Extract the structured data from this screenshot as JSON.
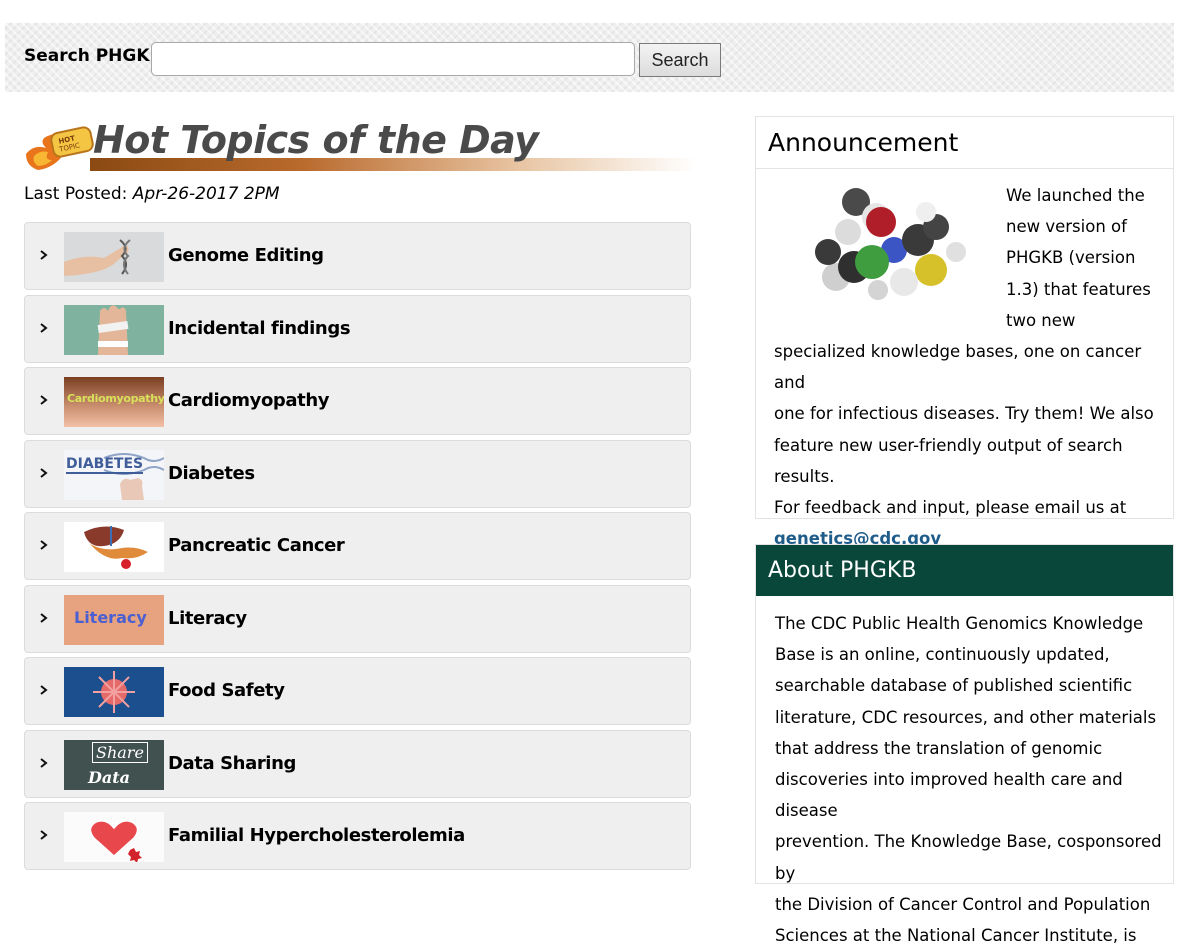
{
  "search": {
    "label": "Search PHGKB:",
    "value": "",
    "placeholder": "",
    "button_label": "Search"
  },
  "hot_topics": {
    "title": "Hot Topics of the Day",
    "icon": "hot-topic-flame-icon",
    "last_posted_label": "Last Posted:",
    "last_posted_value": "Apr-26-2017 2PM",
    "items": [
      {
        "label": "Genome Editing",
        "thumb": "genome-editing-thumbnail"
      },
      {
        "label": "Incidental findings",
        "thumb": "incidental-findings-thumbnail"
      },
      {
        "label": "Cardiomyopathy",
        "thumb": "cardiomyopathy-thumbnail",
        "thumb_text": "Cardiomyopathy"
      },
      {
        "label": "Diabetes",
        "thumb": "diabetes-thumbnail",
        "thumb_text": "DIABETES"
      },
      {
        "label": "Pancreatic Cancer",
        "thumb": "pancreatic-cancer-thumbnail"
      },
      {
        "label": "Literacy",
        "thumb": "literacy-thumbnail",
        "thumb_text": "Literacy"
      },
      {
        "label": "Food Safety",
        "thumb": "food-safety-thumbnail"
      },
      {
        "label": "Data Sharing",
        "thumb": "data-sharing-thumbnail",
        "thumb_text_1": "Share",
        "thumb_text_2": "Data"
      },
      {
        "label": "Familial Hypercholesterolemia",
        "thumb": "familial-hypercholesterolemia-thumbnail"
      }
    ]
  },
  "announcement": {
    "title": "Announcement",
    "image": "molecule-image",
    "lines": [
      "We launched the",
      "new version of",
      "PHGKB (version",
      "1.3) that features",
      "two new",
      "specialized knowledge bases, one on cancer and",
      "one for infectious diseases. Try them! We also",
      "feature new user-friendly output of search results.",
      "For feedback and input, please email us at"
    ],
    "email": "genetics@cdc.gov"
  },
  "about": {
    "title": "About PHGKB",
    "lines": [
      "The CDC Public Health Genomics Knowledge",
      "Base is an online, continuously updated,",
      "searchable database of published scientific",
      "literature, CDC resources, and other materials",
      "that address the translation of genomic",
      "discoveries into improved health care and disease",
      "prevention. The Knowledge Base, cosponsored by",
      "the Division of Cancer Control and Population",
      "Sciences at the National Cancer Institute, is"
    ]
  },
  "colors": {
    "about_header": "#08473a",
    "link": "#1f5c8a",
    "title_gray": "#4a4a4a",
    "underline_brown": "#8a4a12"
  }
}
